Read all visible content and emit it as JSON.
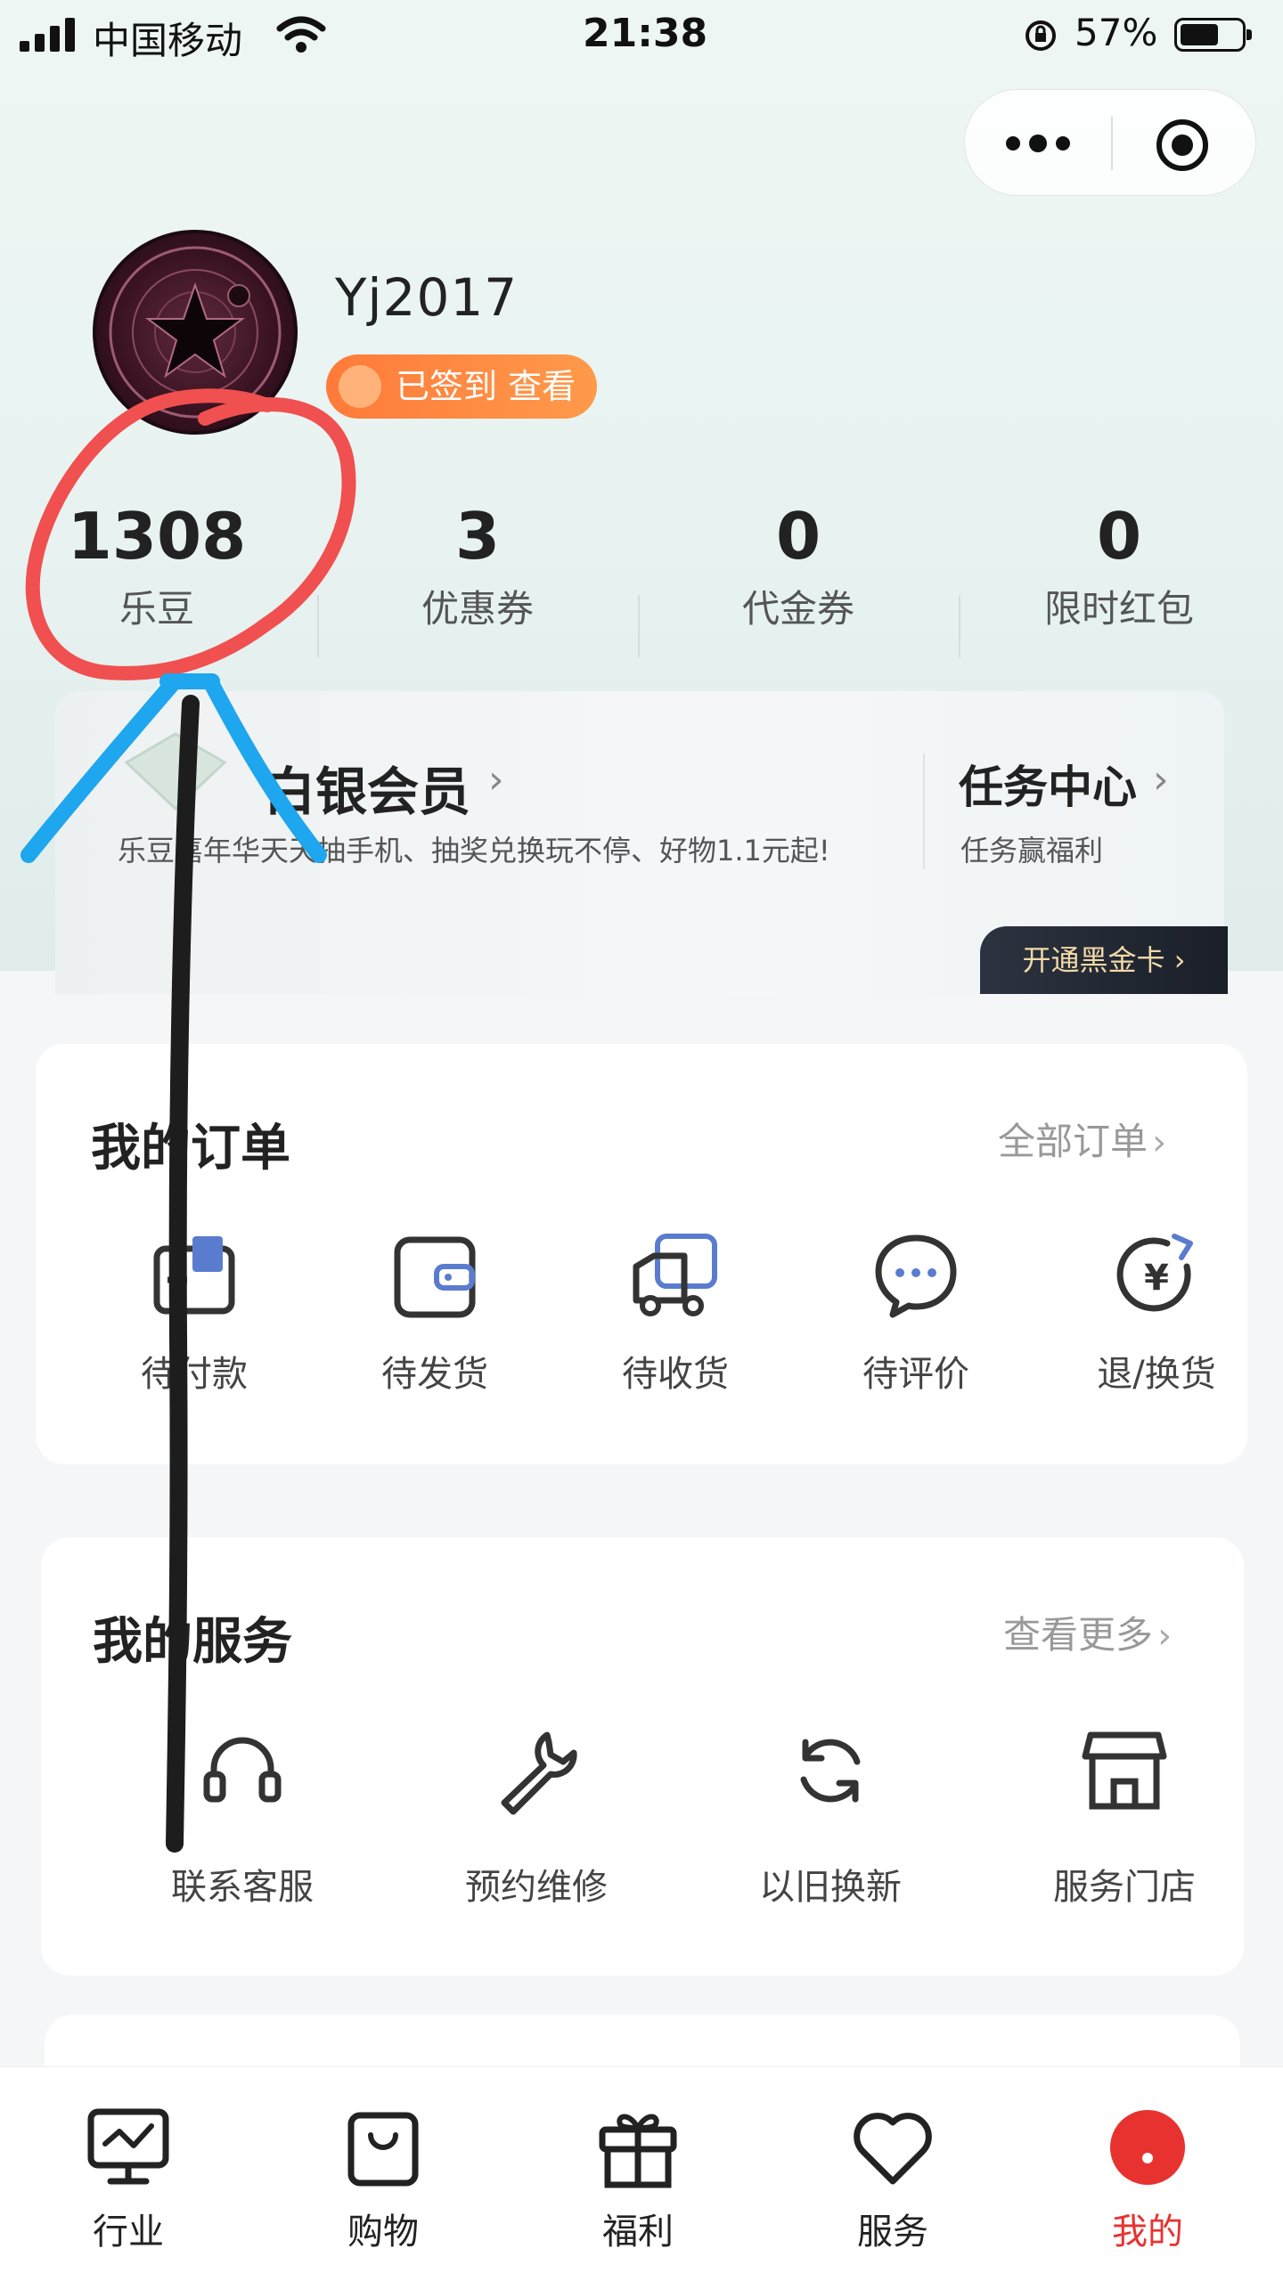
{
  "status_bar": {
    "carrier": "中国移动",
    "time": "21:38",
    "battery": "57%"
  },
  "profile": {
    "username": "Yj2017",
    "signin_label": "已签到 查看"
  },
  "stats": [
    {
      "value": "1308",
      "label": "乐豆"
    },
    {
      "value": "3",
      "label": "优惠券"
    },
    {
      "value": "0",
      "label": "代金券"
    },
    {
      "value": "0",
      "label": "限时红包"
    }
  ],
  "member": {
    "title": "白银会员",
    "subtitle": "乐豆嘉年华天天抽手机、抽奖兑换玩不停、好物1.1元起!",
    "task_title": "任务中心",
    "task_sub": "任务赢福利",
    "black_card": "开通黑金卡"
  },
  "orders": {
    "title": "我的订单",
    "more": "全部订单",
    "items": [
      "待付款",
      "待发货",
      "待收货",
      "待评价",
      "退/换货"
    ]
  },
  "services": {
    "title": "我的服务",
    "more": "查看更多",
    "items": [
      "联系客服",
      "预约维修",
      "以旧换新",
      "服务门店"
    ]
  },
  "tabbar": {
    "items": [
      "行业",
      "购物",
      "福利",
      "服务",
      "我的"
    ],
    "active_color": "#e8322f"
  }
}
